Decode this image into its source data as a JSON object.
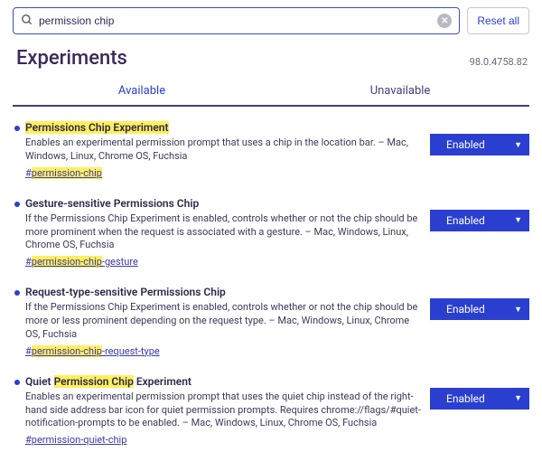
{
  "search": {
    "value": "permission chip",
    "placeholder": ""
  },
  "reset_label": "Reset all",
  "page_title": "Experiments",
  "version": "98.0.4758.82",
  "tabs": {
    "available": "Available",
    "unavailable": "Unavailable"
  },
  "select_label": "Enabled",
  "exps": [
    {
      "title_pre": "",
      "title_hl": "Permissions Chip Experiment",
      "title_post": "",
      "desc": "Enables an experimental permission prompt that uses a chip in the location bar. – Mac, Windows, Linux, Chrome OS, Fuchsia",
      "hash_pre": "#",
      "hash_hl": "permission-chip",
      "hash_post": ""
    },
    {
      "title_pre": "Gesture-sensitive Permissions Chip",
      "title_hl": "",
      "title_post": "",
      "desc": "If the Permissions Chip Experiment is enabled, controls whether or not the chip should be more prominent when the request is associated with a gesture. – Mac, Windows, Linux, Chrome OS, Fuchsia",
      "hash_pre": "#",
      "hash_hl": "permission-chip",
      "hash_post": "-gesture"
    },
    {
      "title_pre": "Request-type-sensitive Permissions Chip",
      "title_hl": "",
      "title_post": "",
      "desc": "If the Permissions Chip Experiment is enabled, controls whether or not the chip should be more or less prominent depending on the request type. – Mac, Windows, Linux, Chrome OS, Fuchsia",
      "hash_pre": "#",
      "hash_hl": "permission-chip",
      "hash_post": "-request-type"
    },
    {
      "title_pre": "Quiet ",
      "title_hl": "Permission Chip",
      "title_post": " Experiment",
      "desc": "Enables an experimental permission prompt that uses the quiet chip instead of the right-hand side address bar icon for quiet permission prompts. Requires chrome://flags/#quiet-notification-prompts to be enabled. – Mac, Windows, Linux, Chrome OS, Fuchsia",
      "hash_pre": "#permission-quiet-chip",
      "hash_hl": "",
      "hash_post": ""
    }
  ]
}
